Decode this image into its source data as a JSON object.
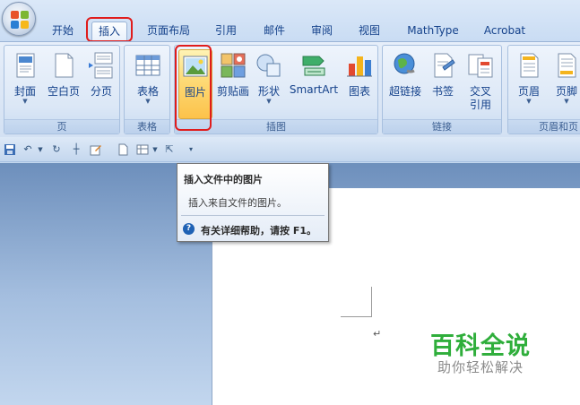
{
  "tabs": [
    {
      "label": "开始"
    },
    {
      "label": "插入"
    },
    {
      "label": "页面布局"
    },
    {
      "label": "引用"
    },
    {
      "label": "邮件"
    },
    {
      "label": "审阅"
    },
    {
      "label": "视图"
    },
    {
      "label": "MathType"
    },
    {
      "label": "Acrobat"
    }
  ],
  "groups": {
    "pages": {
      "label": "页",
      "buttons": [
        "封面",
        "空白页",
        "分页"
      ]
    },
    "tables": {
      "label": "表格",
      "buttons": [
        "表格"
      ]
    },
    "illustrations": {
      "label": "插图",
      "buttons": [
        "图片",
        "剪贴画",
        "形状",
        "SmartArt",
        "图表"
      ]
    },
    "links": {
      "label": "链接",
      "buttons": [
        "超链接",
        "书签",
        "交叉",
        "引用"
      ]
    },
    "header_footer": {
      "label": "页眉和页",
      "buttons": [
        "页眉",
        "页脚"
      ]
    }
  },
  "tooltip": {
    "title": "插入文件中的图片",
    "body": "插入来自文件的图片。",
    "help": "有关详细帮助，请按 F1。"
  },
  "document": {
    "paragraph_mark": "↵"
  },
  "watermark": {
    "main": "百科全说",
    "sub": "助你轻松解决"
  },
  "colors": {
    "accent_highlight": "#e01c1c",
    "watermark_green": "#2fae3b"
  }
}
